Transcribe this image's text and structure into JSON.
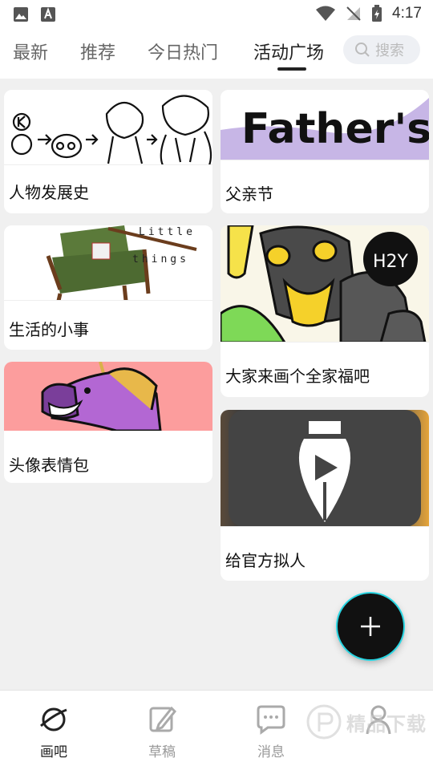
{
  "status_bar": {
    "time": "4:17"
  },
  "top_tabs": [
    {
      "label": "最新"
    },
    {
      "label": "推荐"
    },
    {
      "label": "今日热门"
    },
    {
      "label": "活动广场"
    }
  ],
  "search": {
    "placeholder": "搜索"
  },
  "cards": [
    {
      "title": "人物发展史"
    },
    {
      "title": "父亲节",
      "thumb_text": "Father's"
    },
    {
      "title": "生活的小事",
      "thumb_text_1": "Little",
      "thumb_text_2": "things"
    },
    {
      "title": "大家来画个全家福吧",
      "thumb_text": "H2Y"
    },
    {
      "title": "头像表情包"
    },
    {
      "title": "给官方拟人"
    }
  ],
  "bottom_nav": [
    {
      "label": "画吧",
      "icon": "planet-icon"
    },
    {
      "label": "草稿",
      "icon": "edit-icon"
    },
    {
      "label": "消息",
      "icon": "message-icon"
    },
    {
      "label": "",
      "icon": "profile-icon"
    }
  ],
  "watermark": {
    "text": "精品下载"
  }
}
